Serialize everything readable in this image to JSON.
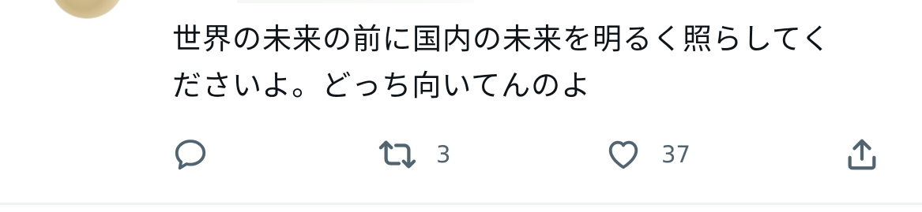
{
  "tweet": {
    "text_lines": [
      "世界の未来の前に国内の未来を明るく照らしてく",
      "ださいよ。どっち向いてんのよ"
    ]
  },
  "actions": {
    "reply": {
      "icon": "reply-icon",
      "count": ""
    },
    "retweet": {
      "icon": "retweet-icon",
      "count": "3"
    },
    "like": {
      "icon": "heart-icon",
      "count": "37"
    },
    "share": {
      "icon": "share-icon"
    }
  },
  "colors": {
    "text": "#0f1419",
    "icon": "#536471",
    "divider": "#eff3f4"
  }
}
